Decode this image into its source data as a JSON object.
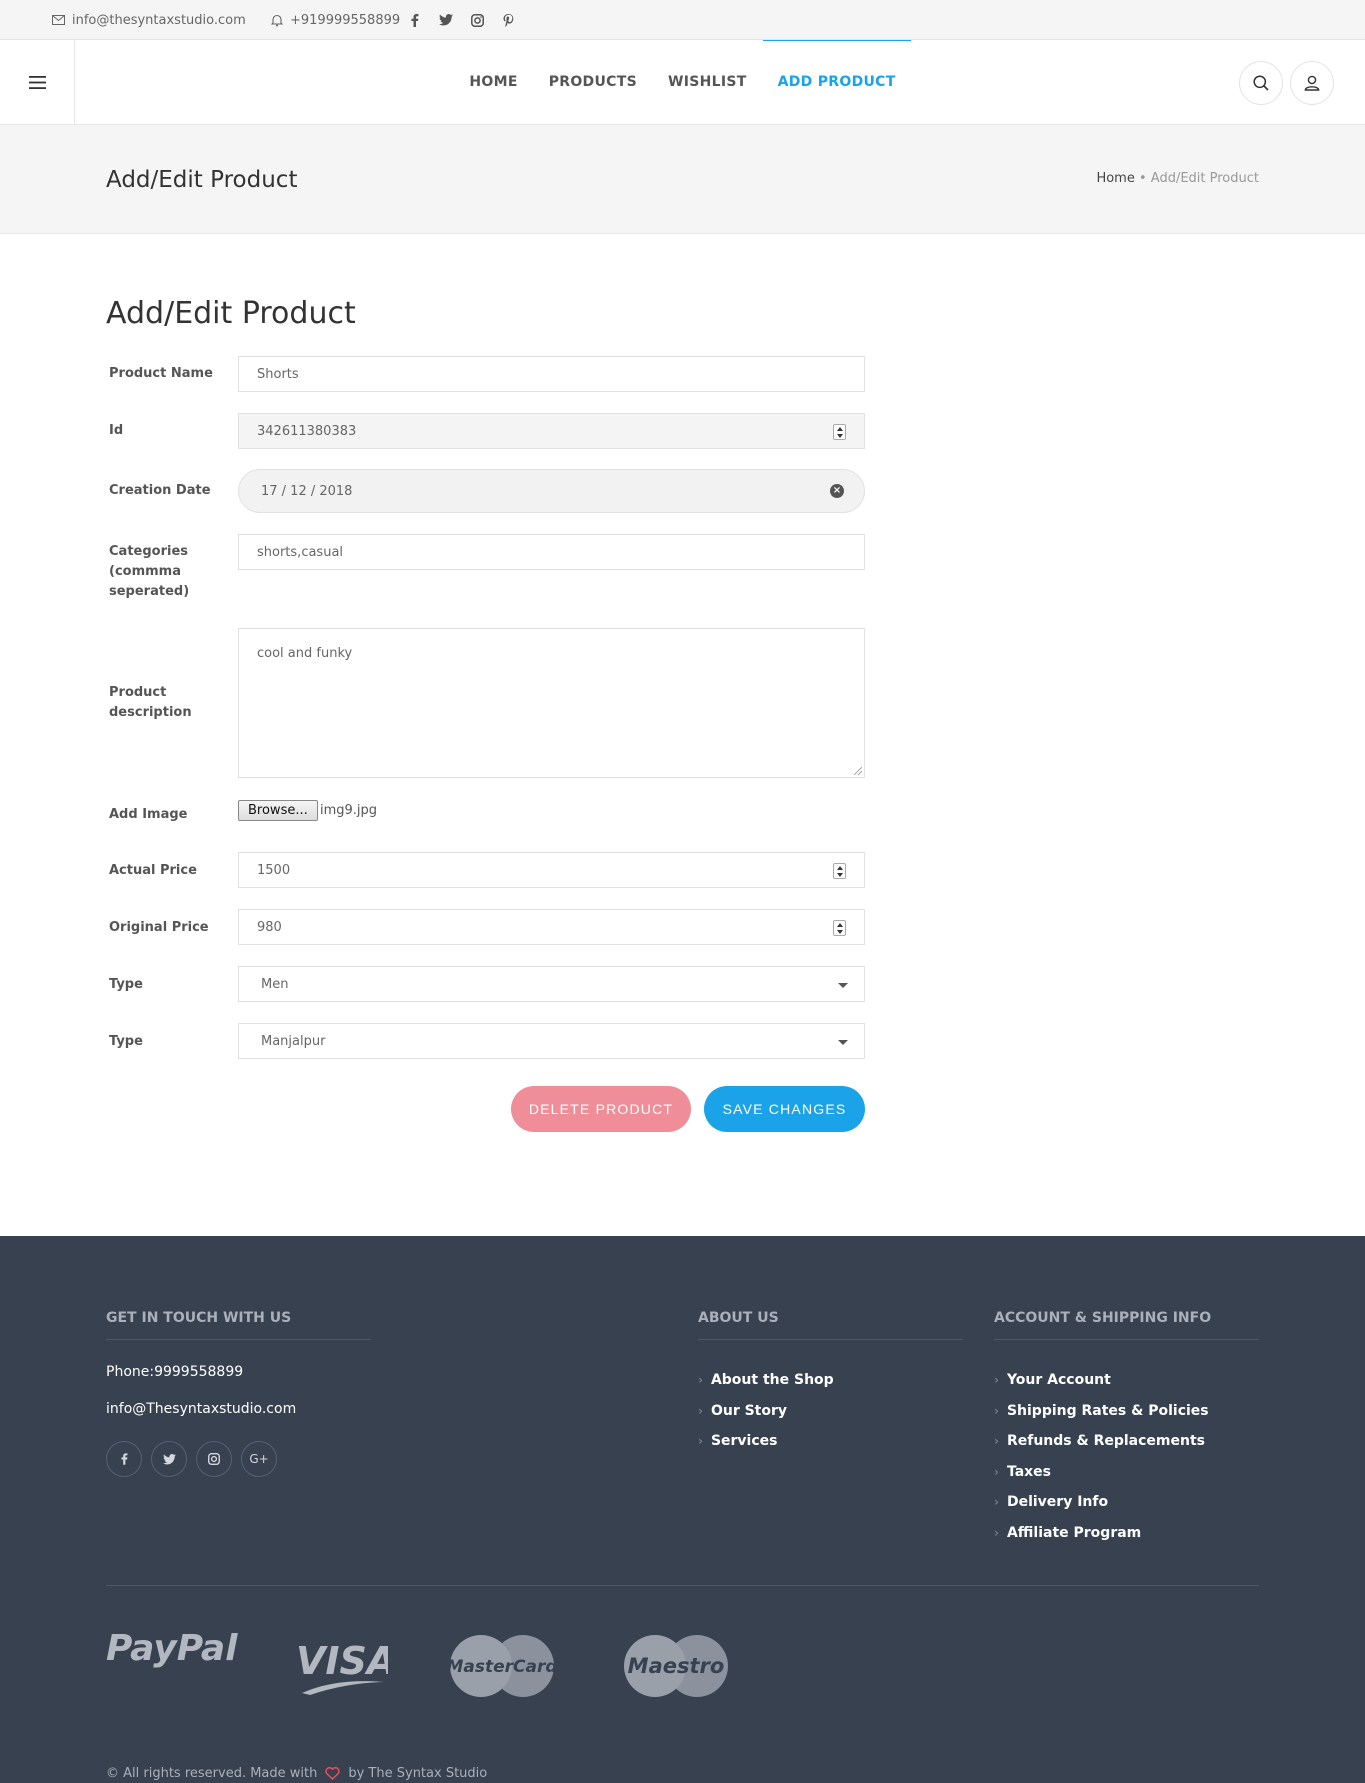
{
  "topbar": {
    "email": "info@thesyntaxstudio.com",
    "phone": "+919999558899",
    "social_icons": [
      "facebook-icon",
      "twitter-icon",
      "instagram-icon",
      "pinterest-icon"
    ]
  },
  "nav": {
    "items": [
      {
        "label": "HOME",
        "active": false
      },
      {
        "label": "PRODUCTS",
        "active": false
      },
      {
        "label": "WISHLIST",
        "active": false
      },
      {
        "label": "ADD PRODUCT",
        "active": true
      }
    ],
    "accent_color": "#1aa3e8"
  },
  "page": {
    "title": "Add/Edit Product",
    "breadcrumb": {
      "home": "Home",
      "separator": "•",
      "current": "Add/Edit Product"
    }
  },
  "form": {
    "title": "Add/Edit Product",
    "product_name": {
      "label": "Product Name",
      "value": "Shorts"
    },
    "id": {
      "label": "Id",
      "value": "342611380383"
    },
    "creation_date": {
      "label": "Creation Date",
      "value": "17 / 12 / 2018"
    },
    "categories": {
      "label_1": "Categories",
      "label_2": "(commma",
      "label_3": "seperated)",
      "value": "shorts,casual"
    },
    "description": {
      "label_1": "Product",
      "label_2": "description",
      "value": "cool and funky"
    },
    "image": {
      "label": "Add Image",
      "button": "Browse...",
      "filename": "img9.jpg"
    },
    "actual_price": {
      "label": "Actual Price",
      "value": "1500"
    },
    "original_price": {
      "label": "Original Price",
      "value": "980"
    },
    "type": {
      "label": "Type",
      "value": "Men"
    },
    "type2": {
      "label": "Type",
      "value": "Manjalpur"
    },
    "delete_label": "DELETE PRODUCT",
    "save_label": "SAVE CHANGES"
  },
  "footer": {
    "contact": {
      "heading": "GET IN TOUCH WITH US",
      "phone": "Phone:9999558899",
      "email": "info@Thesyntaxstudio.com",
      "social": [
        "f",
        "t",
        "ig",
        "G+"
      ]
    },
    "about": {
      "heading": "ABOUT US",
      "links": [
        "About the Shop",
        "Our Story",
        "Services"
      ]
    },
    "account": {
      "heading": "ACCOUNT & SHIPPING INFO",
      "links": [
        "Your Account",
        "Shipping Rates & Policies",
        "Refunds & Replacements",
        "Taxes",
        "Delivery Info",
        "Affiliate Program"
      ]
    },
    "payments": [
      "PayPal",
      "VISA",
      "MasterCard",
      "Maestro"
    ],
    "copyright_pre": "© All rights reserved. Made with",
    "copyright_post": "by The Syntax Studio"
  }
}
